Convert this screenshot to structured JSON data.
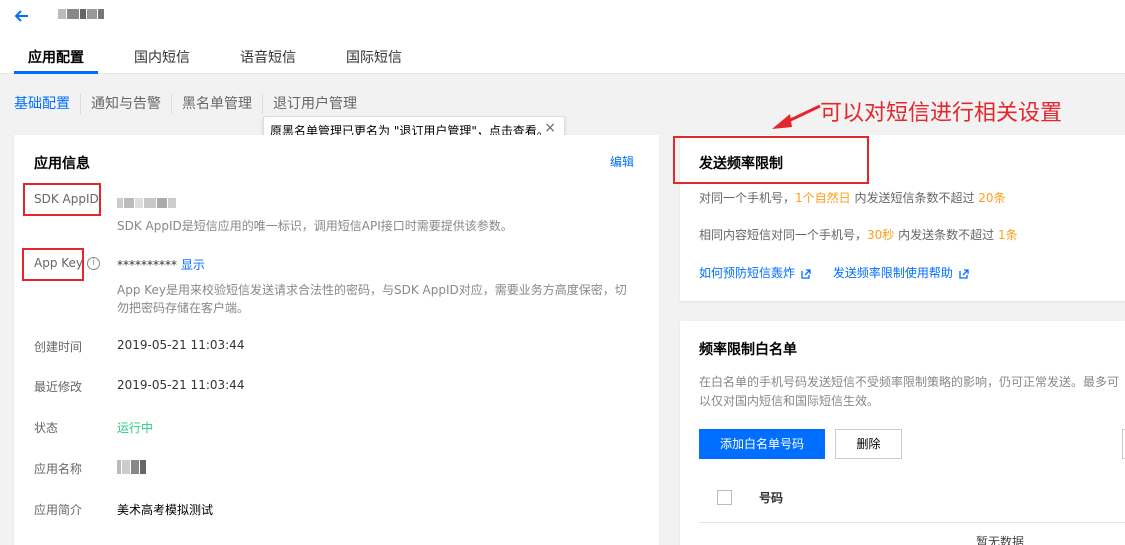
{
  "header": {
    "tabs": [
      {
        "label": "应用配置"
      },
      {
        "label": "国内短信"
      },
      {
        "label": "语音短信"
      },
      {
        "label": "国际短信"
      }
    ]
  },
  "subnav": [
    "基础配置",
    "通知与告警",
    "黑名单管理",
    "退订用户管理"
  ],
  "tooltip": {
    "text": "原黑名单管理已更名为 \"退订用户管理\"，点击查看。",
    "close": "×"
  },
  "app_info": {
    "title": "应用信息",
    "edit": "编辑",
    "sdk_appid_label": "SDK AppID",
    "sdk_appid_desc": "SDK AppID是短信应用的唯一标识，调用短信API接口时需要提供该参数。",
    "app_key_label": "App Key",
    "app_key_value": "**********",
    "app_key_show": "显示",
    "app_key_desc": "App Key是用来校验短信发送请求合法性的密码，与SDK AppID对应，需要业务方高度保密，切勿把密码存储在客户端。",
    "created_label": "创建时间",
    "created_value": "2019-05-21 11:03:44",
    "modified_label": "最近修改",
    "modified_value": "2019-05-21 11:03:44",
    "status_label": "状态",
    "status_value": "运行中",
    "name_label": "应用名称",
    "desc_label": "应用简介",
    "desc_value": "美术高考模拟测试"
  },
  "freq": {
    "title": "发送频率限制",
    "line1_a": "对同一个手机号，",
    "line1_b": "1个自然日",
    "line1_c": " 内发送短信条数不超过 ",
    "line1_d": "20条",
    "line2_a": "相同内容短信对同一个手机号，",
    "line2_b": "30秒",
    "line2_c": " 内发送条数不超过 ",
    "line2_d": "1条",
    "link1": "如何预防短信轰炸",
    "link2": "发送频率限制使用帮助"
  },
  "whitelist": {
    "title": "频率限制白名单",
    "desc": "在白名单的手机号码发送短信不受频率限制策略的影响，仍可正常发送。最多可以仅对国内短信和国际短信生效。",
    "add_button": "添加白名单号码",
    "delete_button": "删除",
    "column": "号码",
    "empty": "暂无数据"
  },
  "annotation": "可以对短信进行相关设置",
  "colors": {
    "accent": "#006eff",
    "annotation_red": "#e4262d",
    "status_green": "#29cc85",
    "highlight_orange": "#ff9c19"
  }
}
